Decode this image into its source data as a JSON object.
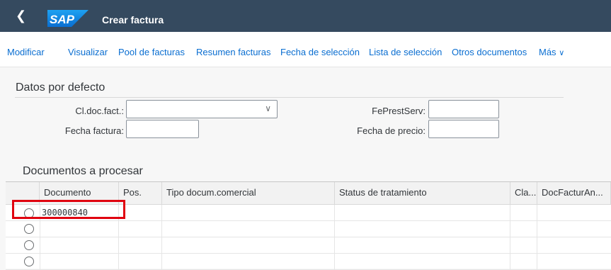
{
  "shell": {
    "title": "Crear factura",
    "logo_text": "SAP"
  },
  "toolbar": {
    "items": [
      "Modificar",
      "Visualizar",
      "Pool de facturas",
      "Resumen facturas",
      "Fecha de selección",
      "Lista de selección",
      "Otros documentos",
      "Más"
    ]
  },
  "defaults": {
    "title": "Datos por defecto",
    "doc_type_label": "Cl.doc.fact.:",
    "doc_type_value": "",
    "invoice_date_label": "Fecha factura:",
    "invoice_date_value": "",
    "service_date_label": "FePrestServ:",
    "service_date_value": "",
    "price_date_label": "Fecha de precio:",
    "price_date_value": ""
  },
  "table": {
    "title": "Documentos a procesar",
    "columns": [
      "Documento",
      "Pos.",
      "Tipo docum.comercial",
      "Status de tratamiento",
      "Cla...",
      "DocFacturAn..."
    ],
    "rows": [
      {
        "documento": "300000840"
      },
      {
        "documento": ""
      },
      {
        "documento": ""
      },
      {
        "documento": ""
      }
    ]
  }
}
